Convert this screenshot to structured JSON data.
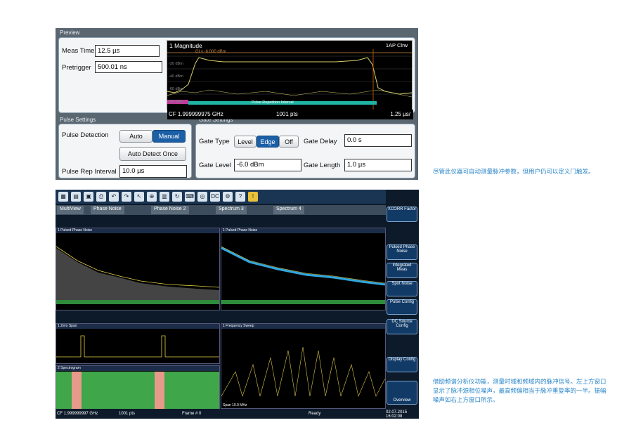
{
  "preview": {
    "title": "Preview",
    "meas_time_label": "Meas Time",
    "meas_time_value": "12.5 µs",
    "pretrigger_label": "Pretrigger",
    "pretrigger_value": "500.01 ns",
    "plot": {
      "title": "1 Magnitude",
      "legend": "1AP Clrw",
      "level_text": "GLv -6.000 dBm",
      "band_label": "Pulse Repetition Interval",
      "foot_left": "CF 1.999999975 GHz",
      "foot_mid": "1001 pts",
      "foot_right": "1.25 µs/",
      "y_labels": [
        "-20 dBm",
        "-40 dBm",
        "-60 dBm",
        "-80 dBm"
      ]
    }
  },
  "pulse_settings": {
    "title": "Pulse Settings",
    "detection_label": "Pulse Detection",
    "auto_label": "Auto",
    "manual_label": "Manual",
    "auto_detect_label": "Auto Detect Once",
    "rep_interval_label": "Pulse Rep Interval",
    "rep_interval_value": "10.0 µs"
  },
  "gate_settings": {
    "title": "Gate Settings",
    "gate_type_label": "Gate Type",
    "level_btn": "Level",
    "edge_btn": "Edge",
    "off_btn": "Off",
    "gate_delay_label": "Gate Delay",
    "gate_delay_value": "0.0 s",
    "gate_level_label": "Gate Level",
    "gate_level_value": "-6.0 dBm",
    "gate_length_label": "Gate Length",
    "gate_length_value": "1.0 µs"
  },
  "notes": {
    "note1": "尽管此仪器可自动测量脉冲参数，但用户仍可以定义门触发。",
    "note2": "借助频谱分析仪功能，测量时域和频域内的脉冲信号。左上方窗口显示了脉冲源相位噪声，最高频偏相当于脉冲重复率的一半。振幅噪声如右上方窗口所示。"
  },
  "analyzer": {
    "tabs": [
      "MultiView",
      "Phase Noise",
      "Phase Noise 2",
      "Spectrum 3",
      "Spectrum 4"
    ],
    "softkeys": [
      "XCORR Factor",
      "Pulsed Phase Noise",
      "Integrated Meas",
      "Spot Noise",
      "Pulse Config",
      "DC Source Config",
      "Display Config",
      "Overview"
    ],
    "win1_title": "1 Pulsed Phase Noise",
    "win2_title": "1 Pulsed Phase Noise",
    "win3_title": "1 Zero Span",
    "win4_title": "2 Spectrogram",
    "win5_title": "1 Frequency Sweep",
    "foot_left": "CF 1.999999997 GHz",
    "foot_pts": "1001 pts",
    "foot_frame": "Frame # 0",
    "foot_span": "Span 10.0 MHz",
    "status_ready": "Ready",
    "status_date": "02.07.2015",
    "status_time": "16:02:08"
  }
}
